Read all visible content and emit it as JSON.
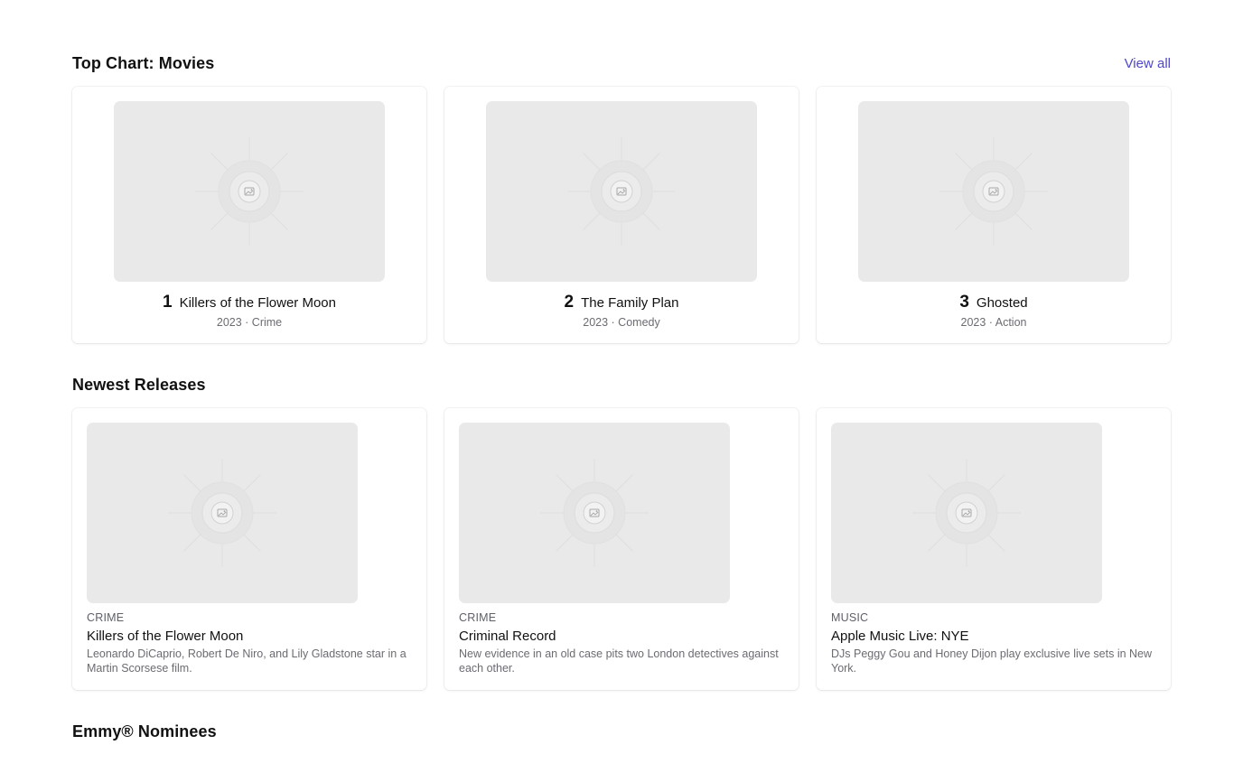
{
  "top_chart": {
    "title": "Top Chart: Movies",
    "view_all_label": "View all",
    "items": [
      {
        "rank": "1",
        "title": "Killers of the Flower Moon",
        "meta": "2023 · Crime"
      },
      {
        "rank": "2",
        "title": "The Family Plan",
        "meta": "2023 · Comedy"
      },
      {
        "rank": "3",
        "title": "Ghosted",
        "meta": "2023 · Action"
      }
    ]
  },
  "newest_releases": {
    "title": "Newest Releases",
    "items": [
      {
        "category": "CRIME",
        "title": "Killers of the Flower Moon",
        "description": "Leonardo DiCaprio, Robert De Niro, and Lily Gladstone star in a Martin Scorsese film."
      },
      {
        "category": "CRIME",
        "title": "Criminal Record",
        "description": "New evidence in an old case pits two London detectives against each other."
      },
      {
        "category": "MUSIC",
        "title": "Apple Music Live: NYE",
        "description": "DJs Peggy Gou and Honey Dijon play exclusive live sets in New York."
      }
    ]
  },
  "emmy": {
    "title": "Emmy® Nominees"
  },
  "colors": {
    "accent": "#4f46c8",
    "placeholder_bg": "#e9e9e9",
    "muted_text": "#6b6b72"
  },
  "icons": {
    "placeholder": "image-placeholder-icon"
  }
}
